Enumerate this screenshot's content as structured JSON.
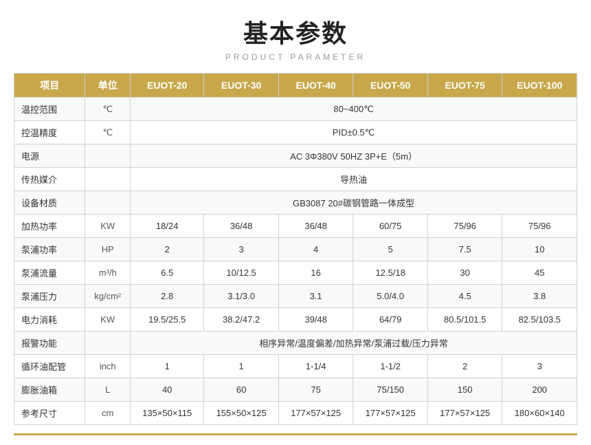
{
  "title": "基本参数",
  "subtitle": "PRODUCT PARAMETER",
  "table": {
    "headers": [
      "项目",
      "单位",
      "EUOT-20",
      "EUOT-30",
      "EUOT-40",
      "EUOT-50",
      "EUOT-75",
      "EUOT-100"
    ],
    "rows": [
      {
        "label": "温控范围",
        "unit": "℃",
        "span": true,
        "spanValue": "80~400℃"
      },
      {
        "label": "控温精度",
        "unit": "℃",
        "span": true,
        "spanValue": "PID±0.5℃"
      },
      {
        "label": "电源",
        "unit": "",
        "span": true,
        "spanValue": "AC 3Φ380V 50HZ 3P+E（5m）"
      },
      {
        "label": "传热媒介",
        "unit": "",
        "span": true,
        "spanValue": "导热油"
      },
      {
        "label": "设备材质",
        "unit": "",
        "span": true,
        "spanValue": "GB3087   20#碳钢管路一体成型"
      },
      {
        "label": "加热功率",
        "unit": "KW",
        "span": false,
        "values": [
          "18/24",
          "36/48",
          "36/48",
          "60/75",
          "75/96",
          "75/96"
        ]
      },
      {
        "label": "泵浦功率",
        "unit": "HP",
        "span": false,
        "values": [
          "2",
          "3",
          "4",
          "5",
          "7.5",
          "10"
        ]
      },
      {
        "label": "泵浦流量",
        "unit": "m³/h",
        "span": false,
        "values": [
          "6.5",
          "10/12.5",
          "16",
          "12.5/18",
          "30",
          "45"
        ]
      },
      {
        "label": "泵浦压力",
        "unit": "kg/cm²",
        "span": false,
        "values": [
          "2.8",
          "3.1/3.0",
          "3.1",
          "5.0/4.0",
          "4.5",
          "3.8"
        ]
      },
      {
        "label": "电力消耗",
        "unit": "KW",
        "span": false,
        "values": [
          "19.5/25.5",
          "38.2/47.2",
          "39/48",
          "64/79",
          "80.5/101.5",
          "82.5/103.5"
        ]
      },
      {
        "label": "报警功能",
        "unit": "",
        "span": true,
        "spanValue": "相序异常/温度偏差/加热异常/泵浦过载/压力异常"
      },
      {
        "label": "循环油配管",
        "unit": "inch",
        "span": false,
        "values": [
          "1",
          "1",
          "1-1/4",
          "1-1/2",
          "2",
          "3"
        ]
      },
      {
        "label": "膨胀油箱",
        "unit": "L",
        "span": false,
        "values": [
          "40",
          "60",
          "75",
          "75/150",
          "150",
          "200"
        ]
      },
      {
        "label": "参考尺寸",
        "unit": "cm",
        "span": false,
        "values": [
          "135×50×115",
          "155×50×125",
          "177×57×125",
          "177×57×125",
          "177×57×125",
          "180×60×140"
        ]
      }
    ]
  }
}
